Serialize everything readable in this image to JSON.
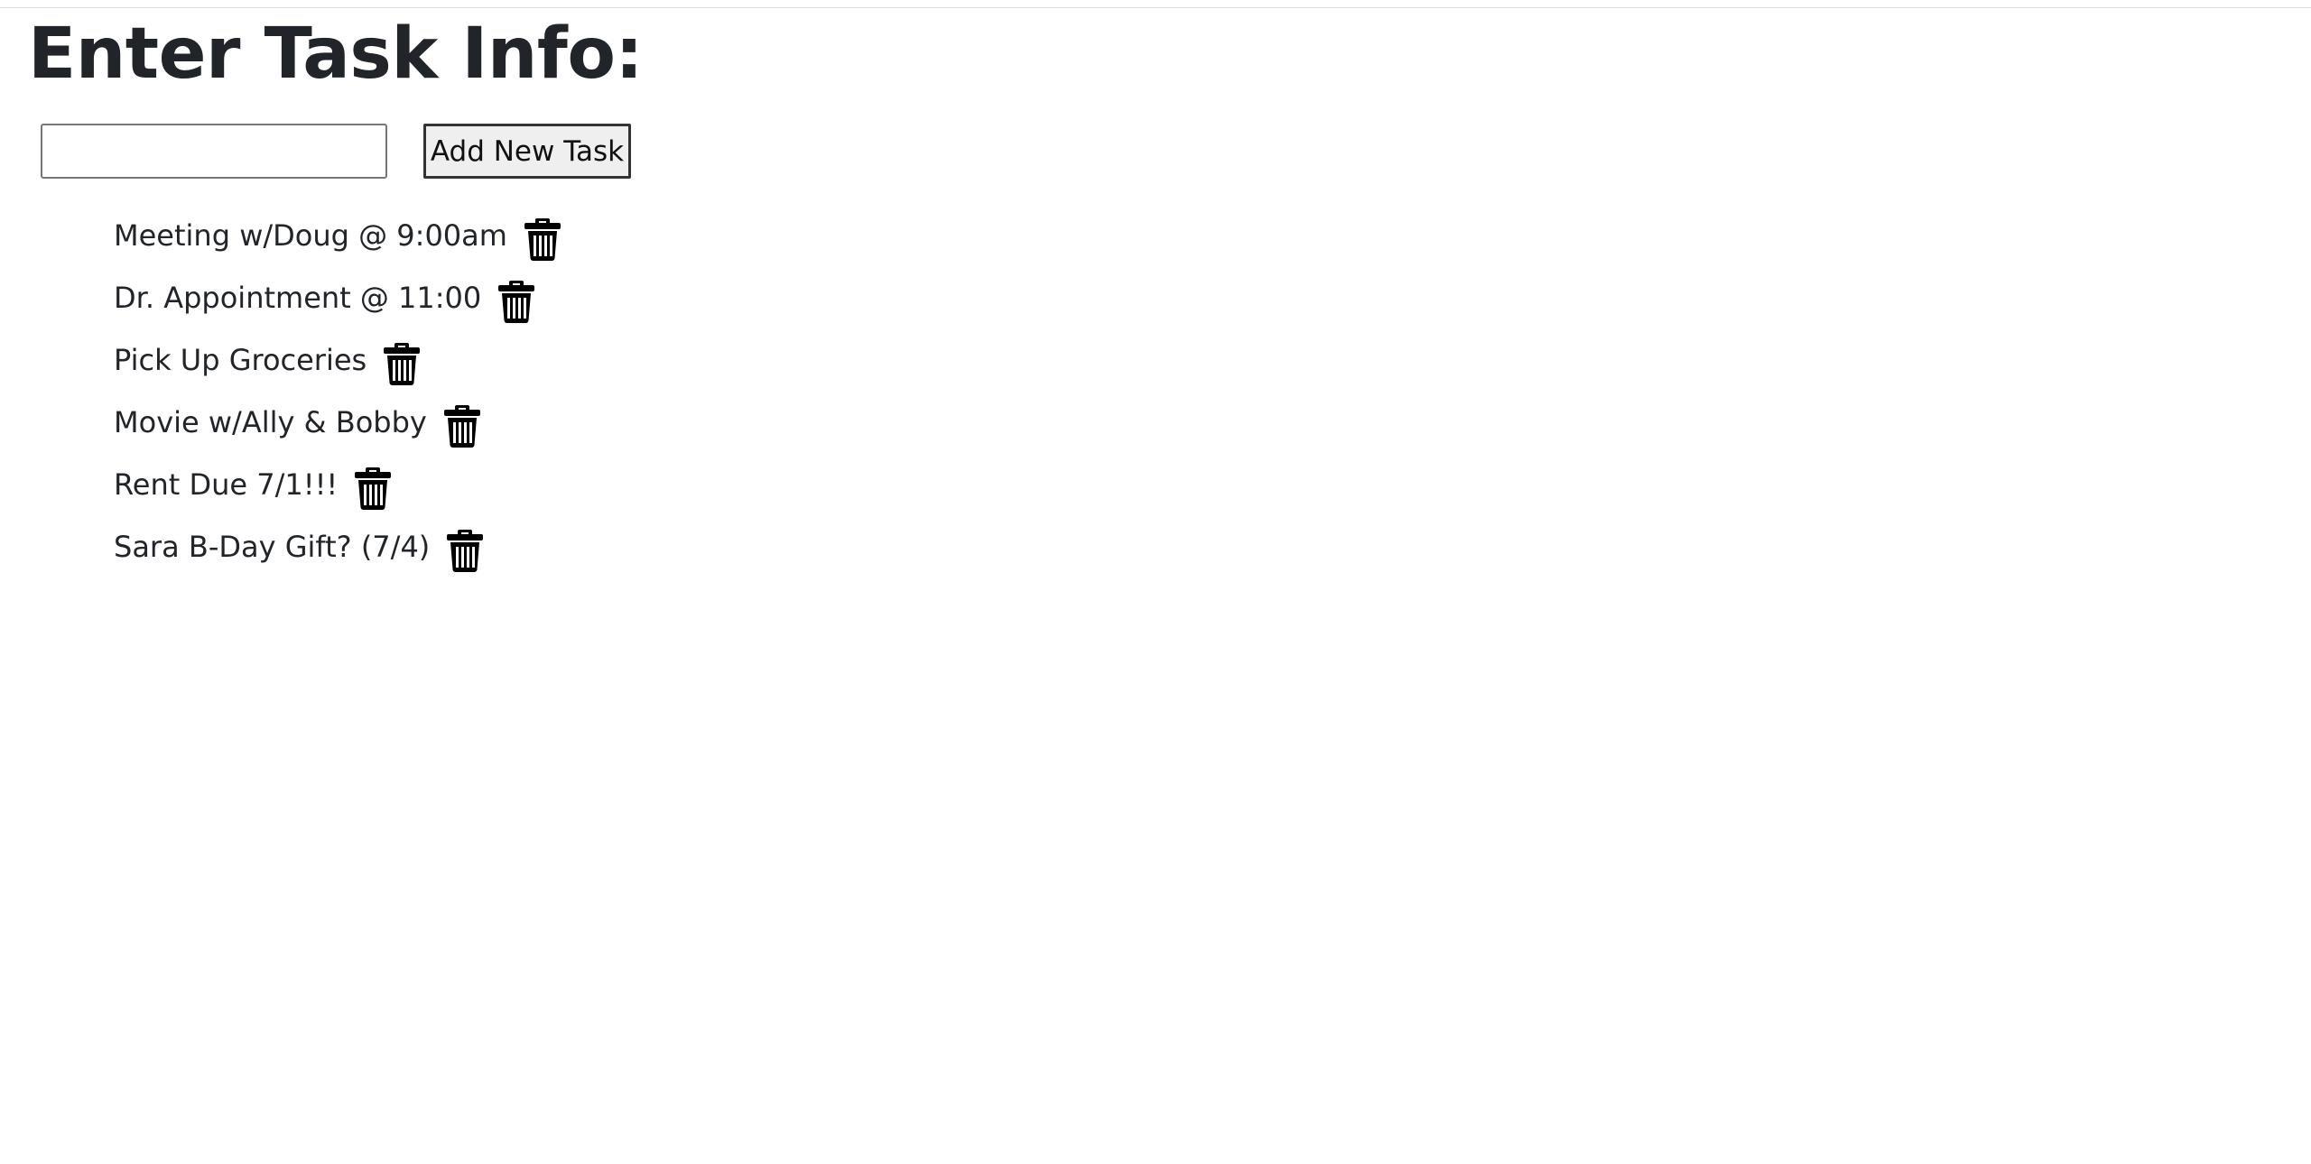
{
  "page": {
    "title": "Enter Task Info:"
  },
  "form": {
    "input_value": "",
    "placeholder": "",
    "add_button_label": "Add New Task"
  },
  "tasks": [
    {
      "text": "Meeting w/Doug @ 9:00am",
      "icon": "trash-icon"
    },
    {
      "text": "Dr. Appointment @ 11:00",
      "icon": "trash-icon"
    },
    {
      "text": "Pick Up Groceries",
      "icon": "trash-icon"
    },
    {
      "text": "Movie w/Ally & Bobby",
      "icon": "trash-icon"
    },
    {
      "text": "Rent Due 7/1!!!",
      "icon": "trash-icon"
    },
    {
      "text": "Sara B-Day Gift? (7/4)",
      "icon": "trash-icon"
    }
  ],
  "colors": {
    "text": "#212529",
    "icon": "#000000",
    "button_bg": "#efefef"
  }
}
